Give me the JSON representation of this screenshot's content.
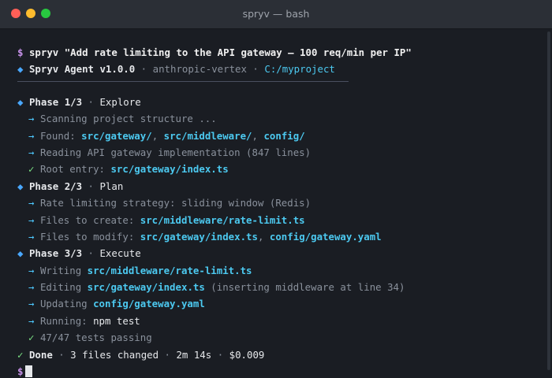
{
  "window": {
    "title": "spryv — bash"
  },
  "command": {
    "prompt": "$",
    "text": "spryv \"Add rate limiting to the API gateway — 100 req/min per IP\""
  },
  "agent": {
    "marker": "◆",
    "name": "Spryv Agent v1.0.0",
    "sep1": " · ",
    "provider": "anthropic-vertex",
    "sep2": " · ",
    "path": "C:/myproject"
  },
  "phases": [
    {
      "label": "Phase 1/3",
      "name": "Explore",
      "steps": [
        {
          "icon": "→",
          "pre": "Scanning project structure ...",
          "items": []
        },
        {
          "icon": "→",
          "pre": "Found: ",
          "items": [
            {
              "val": "src/gateway/",
              "after": ", "
            },
            {
              "val": "src/middleware/",
              "after": ", "
            },
            {
              "val": "config/",
              "after": ""
            }
          ]
        },
        {
          "icon": "→",
          "pre": "Reading API gateway implementation (847 lines)",
          "items": []
        },
        {
          "icon": "✓",
          "pre": "Root entry: ",
          "items": [
            {
              "val": "src/gateway/index.ts",
              "after": ""
            }
          ]
        }
      ]
    },
    {
      "label": "Phase 2/3",
      "name": "Plan",
      "steps": [
        {
          "icon": "→",
          "pre": "Rate limiting strategy: sliding window (Redis)",
          "items": []
        },
        {
          "icon": "→",
          "pre": "Files to create: ",
          "items": [
            {
              "val": "src/middleware/rate-limit.ts",
              "after": ""
            }
          ]
        },
        {
          "icon": "→",
          "pre": "Files to modify: ",
          "items": [
            {
              "val": "src/gateway/index.ts",
              "after": ", "
            },
            {
              "val": "config/gateway.yaml",
              "after": ""
            }
          ]
        }
      ]
    },
    {
      "label": "Phase 3/3",
      "name": "Execute",
      "steps": [
        {
          "icon": "→",
          "pre": "Writing ",
          "items": [
            {
              "val": "src/middleware/rate-limit.ts",
              "after": ""
            }
          ]
        },
        {
          "icon": "→",
          "pre": "Editing ",
          "items": [
            {
              "val": "src/gateway/index.ts",
              "after": " (inserting middleware at line 34)"
            }
          ]
        },
        {
          "icon": "→",
          "pre": "Updating ",
          "items": [
            {
              "val": "config/gateway.yaml",
              "after": ""
            }
          ]
        },
        {
          "icon": "→",
          "pre": "Running: ",
          "items": [
            {
              "val": "npm test",
              "after": "",
              "plain": true
            }
          ]
        },
        {
          "icon": "✓",
          "pre": "47/47 tests passing",
          "items": []
        }
      ]
    }
  ],
  "summary": {
    "icon": "✓",
    "label": "Done",
    "files": "3 files changed",
    "time": "2m 14s",
    "cost": "$0.009"
  },
  "prompt_end": "$",
  "colors": {
    "accent": "#4aa8ff",
    "path": "#4cc9f0",
    "success": "#7ee787",
    "prompt": "#c792ea"
  }
}
